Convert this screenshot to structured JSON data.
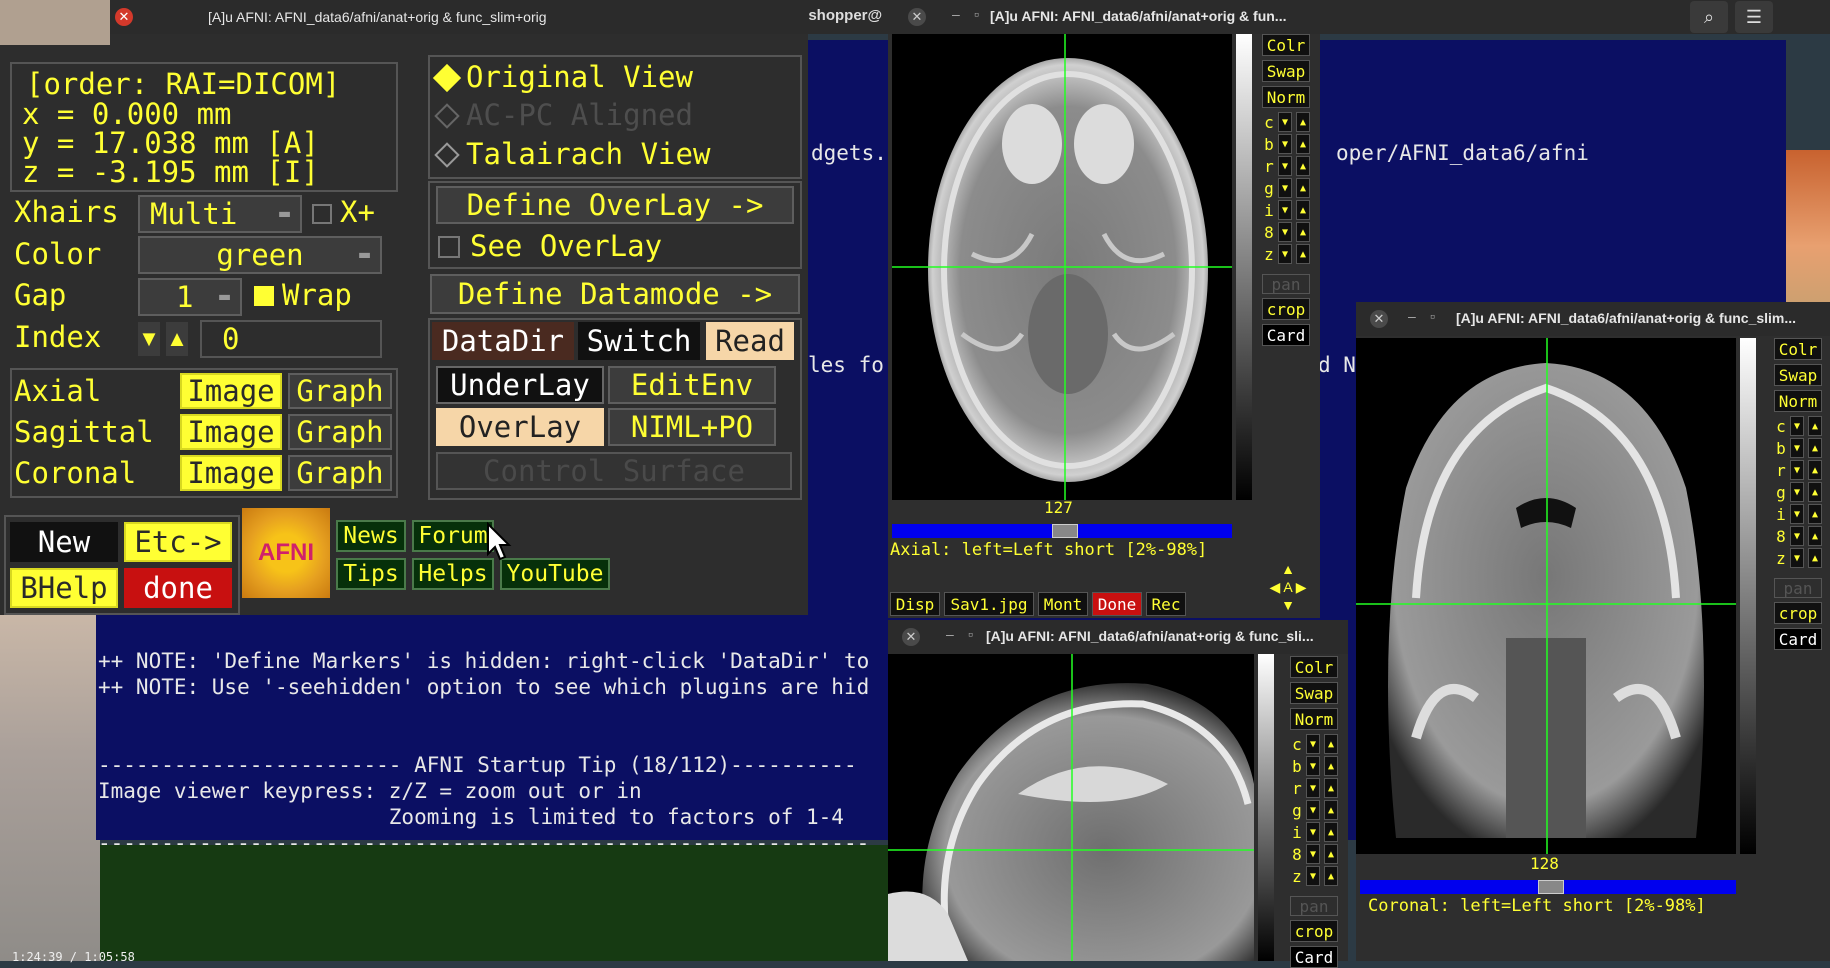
{
  "colors": {
    "afni_yellow": "#ffff33",
    "term_blue": "#0b0f63",
    "crosshair": "#22ff22",
    "afni_bg": "#2d2d2d"
  },
  "terminal": {
    "title_fragment": "sshopper@",
    "line_widgets": "dgets.",
    "line_path": "oper/AFNI_data6/afni",
    "line_les": "les fo",
    "line_dn": "d N",
    "note1": "++ NOTE: 'Define Markers' is hidden: right-click 'DataDir' to",
    "note2": "++ NOTE: Use '-seehidden' option to see which plugins are hid",
    "tip_header": "------------------------ AFNI Startup Tip (18/112)----------",
    "tip_line1": "Image viewer keypress: z/Z = zoom out or in",
    "tip_line2": "                       Zooming is limited to factors of 1-4",
    "tip_rule": "-------------------------------------------------------------",
    "clock": "1:24:39 / 1:05:58"
  },
  "controller": {
    "title": "[A]u AFNI: AFNI_data6/afni/anat+orig & func_slim+orig",
    "coords": {
      "order": "[order: RAI=DICOM]",
      "x": "x =     0.000 mm",
      "y": "y =    17.038 mm [A]",
      "z": "z =    -3.195 mm [I]"
    },
    "xhairs_label": "Xhairs",
    "xhairs_value": "Multi",
    "xplus": "X+",
    "color_label": "Color",
    "color_value": "green",
    "gap_label": "Gap",
    "gap_value": "1",
    "wrap": "Wrap",
    "index_label": "Index",
    "index_value": "0",
    "views": [
      {
        "name": "Axial",
        "image": "Image",
        "graph": "Graph"
      },
      {
        "name": "Sagittal",
        "image": "Image",
        "graph": "Graph"
      },
      {
        "name": "Coronal",
        "image": "Image",
        "graph": "Graph"
      }
    ],
    "original_view": "Original View",
    "acpc": "AC-PC Aligned",
    "talairach": "Talairach View",
    "define_overlay": "Define OverLay ->",
    "see_overlay": "See OverLay",
    "define_datamode": "Define Datamode ->",
    "datadir": "DataDir",
    "switch": "Switch",
    "read": "Read",
    "underlay": "UnderLay",
    "editenv": "EditEnv",
    "overlay": "OverLay",
    "nimlpo": "NIML+PO",
    "control_surface": "Control Surface",
    "new": "New",
    "etc": "Etc->",
    "bhelp": "BHelp",
    "done": "done",
    "logo": "AFNI",
    "news": "News",
    "forum": "Forum",
    "tips": "Tips",
    "helps": "Helps",
    "youtube": "YouTube"
  },
  "axial": {
    "title": "[A]u AFNI: AFNI_data6/afni/anat+orig & fun...",
    "slice": "127",
    "label": "Axial: left=Left short [2%-98%]",
    "bottom": [
      "Disp",
      "Sav1.jpg",
      "Mont",
      "Done",
      "Rec"
    ]
  },
  "sagittal": {
    "title": "[A]u AFNI: AFNI_data6/afni/anat+orig & func_sli..."
  },
  "coronal": {
    "title": "[A]u AFNI: AFNI_data6/afni/anat+orig & func_slim...",
    "slice": "128",
    "label": "Coronal: left=Left short [2%-98%]"
  },
  "side": {
    "colr": "Colr",
    "swap": "Swap",
    "norm": "Norm",
    "letters": [
      "c",
      "b",
      "r",
      "g",
      "i",
      "8",
      "z"
    ],
    "pan": "pan",
    "crop": "crop",
    "card": "Card"
  }
}
